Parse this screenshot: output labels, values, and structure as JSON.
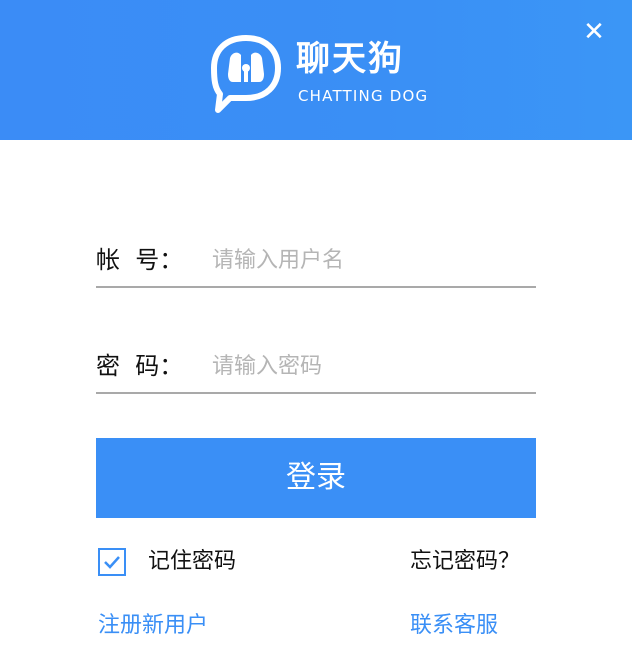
{
  "colors": {
    "header_bg": "#3a8ff6",
    "accent": "#3a8ff6",
    "text": "#111111",
    "placeholder": "#b5b5b5",
    "underline": "#a9a9a9"
  },
  "header": {
    "brand_cn": "聊天狗",
    "brand_en": "CHATTING DOG",
    "logo_icon": "chat-bubble-icon",
    "close_icon": "close-icon",
    "close_glyph": "✕"
  },
  "form": {
    "username": {
      "label": "帐  号：",
      "placeholder": "请输入用户名",
      "value": ""
    },
    "password": {
      "label": "密  码：",
      "placeholder": "请输入密码",
      "value": ""
    },
    "login_label": "登录",
    "remember": {
      "label": "记住密码",
      "checked": true,
      "icon": "checkmark-icon"
    },
    "forgot_label": "忘记密码？",
    "register_label": "注册新用户",
    "contact_label": "联系客服"
  }
}
